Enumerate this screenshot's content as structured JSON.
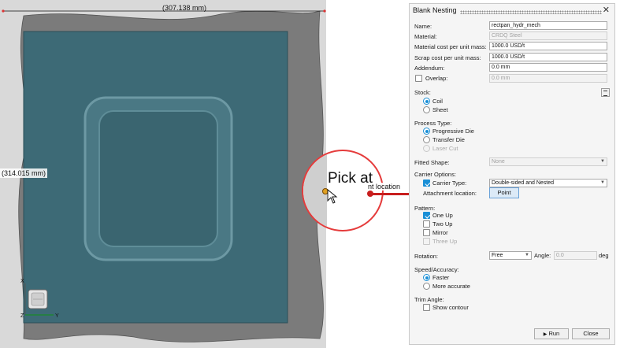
{
  "viewport": {
    "dim_top": "(307.138 mm)",
    "dim_left": "(314.015 mm)",
    "triad_labels": {
      "x": "X",
      "y": "Y",
      "z": "Z"
    },
    "magnifier_text": "Pick at",
    "callout_text": "nt location"
  },
  "panel": {
    "title": "Blank Nesting",
    "close_glyph": "✕",
    "name": {
      "label": "Name:",
      "value": "rectpan_hydr_mech"
    },
    "material": {
      "label": "Material:",
      "value": "CRDQ Steel"
    },
    "material_cost": {
      "label": "Material cost per unit mass:",
      "value": "1000.0 USD/t"
    },
    "scrap_cost": {
      "label": "Scrap cost per unit mass:",
      "value": "1000.0 USD/t"
    },
    "addendum": {
      "label": "Addendum:",
      "value": "0.0 mm"
    },
    "overlap": {
      "label": "Overlap:",
      "value": "0.0 mm",
      "checked": false
    },
    "stock": {
      "label": "Stock:",
      "options": [
        "Coil",
        "Sheet"
      ],
      "selected": "Coil"
    },
    "process_type": {
      "label": "Process Type:",
      "options": [
        "Progressive Die",
        "Transfer Die",
        "Laser Cut"
      ],
      "selected": "Progressive Die"
    },
    "fitted_shape": {
      "label": "Fitted Shape:",
      "value": "None"
    },
    "carrier_options": {
      "label": "Carrier Options:",
      "carrier_type_label": "Carrier Type:",
      "carrier_type_value": "Double-sided and Nested",
      "carrier_checked": true
    },
    "attachment": {
      "label": "Attachment location:",
      "button": "Point"
    },
    "pattern": {
      "label": "Pattern:",
      "options": [
        {
          "label": "One Up",
          "checked": true,
          "disabled": false
        },
        {
          "label": "Two Up",
          "checked": false,
          "disabled": false
        },
        {
          "label": "Mirror",
          "checked": false,
          "disabled": false
        },
        {
          "label": "Three Up",
          "checked": false,
          "disabled": true
        }
      ]
    },
    "rotation": {
      "label": "Rotation:",
      "value": "Free",
      "angle_label": "Angle:",
      "angle_value": "0.0",
      "unit": "deg"
    },
    "speed": {
      "label": "Speed/Accuracy:",
      "options": [
        "Faster",
        "More accurate"
      ],
      "selected": "Faster"
    },
    "trim_angle": {
      "label": "Trim Angle:",
      "show_contour": "Show contour",
      "checked": false
    },
    "run_button": "Run",
    "close_button": "Close",
    "run_glyph": "▶"
  },
  "colors": {
    "part": "#3d6a76",
    "blank": "#7b7b7b",
    "accent": "#1a8fd6",
    "pick": "#e53b3b"
  }
}
